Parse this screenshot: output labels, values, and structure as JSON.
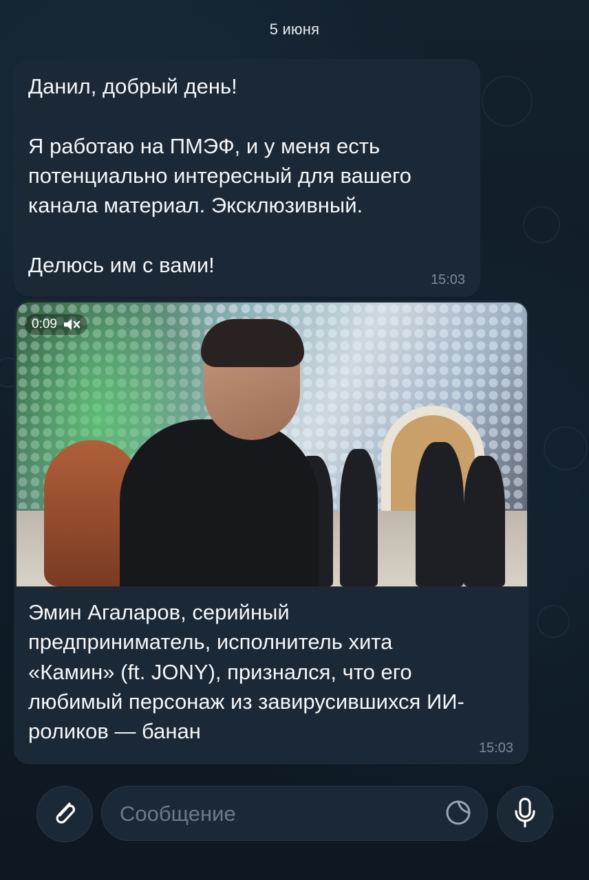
{
  "chat": {
    "date_separator": "5 июня"
  },
  "messages": [
    {
      "text": "Данил, добрый день!\n\nЯ работаю на ПМЭФ, и у меня есть потенциально интересный для вашего канала материал. Эксклюзивный.\n\nДелюсь им с вами!",
      "time": "15:03"
    },
    {
      "video": {
        "duration": "0:09",
        "muted_icon": "speaker-muted-icon"
      },
      "caption": "Эмин Агаларов, серийный предприниматель, исполнитель хита «Камин» (ft. JONY), признался, что его любимый персонаж из завирусившихся ИИ-роликов — банан",
      "time": "15:03"
    }
  ],
  "composer": {
    "placeholder": "Сообщение",
    "attach_icon": "paperclip-icon",
    "sticker_icon": "sticker-icon",
    "mic_icon": "microphone-icon"
  },
  "colors": {
    "background": "#0f1a24",
    "bubble": "#1b2835",
    "time_text": "#7d8c99"
  }
}
